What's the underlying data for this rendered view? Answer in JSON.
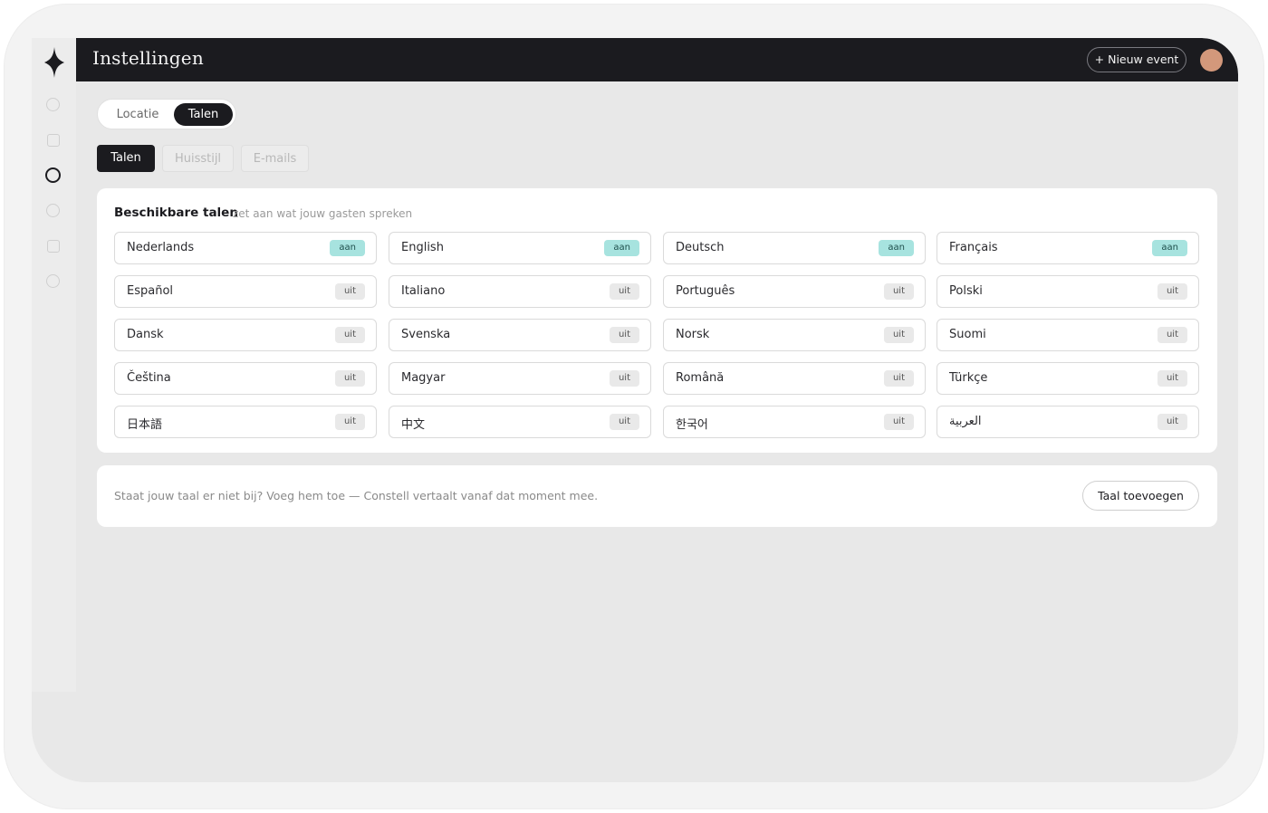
{
  "header": {
    "title": "Instellingen",
    "new_event_label": "+ Nieuw event"
  },
  "segment": {
    "options": [
      "Locatie",
      "Talen"
    ],
    "selected": "Talen"
  },
  "tabs": [
    {
      "label": "Talen",
      "active": true
    },
    {
      "label": "Huisstijl",
      "active": false
    },
    {
      "label": "E-mails",
      "active": false
    }
  ],
  "languages_card": {
    "heading": "Beschikbare talen",
    "subheading": "zet aan wat jouw gasten spreken",
    "items": [
      {
        "name": "Nederlands",
        "status": "aan"
      },
      {
        "name": "English",
        "status": "aan"
      },
      {
        "name": "Deutsch",
        "status": "aan"
      },
      {
        "name": "Français",
        "status": "aan"
      },
      {
        "name": "Español",
        "status": "uit"
      },
      {
        "name": "Italiano",
        "status": "uit"
      },
      {
        "name": "Português",
        "status": "uit"
      },
      {
        "name": "Polski",
        "status": "uit"
      },
      {
        "name": "Dansk",
        "status": "uit"
      },
      {
        "name": "Svenska",
        "status": "uit"
      },
      {
        "name": "Norsk",
        "status": "uit"
      },
      {
        "name": "Suomi",
        "status": "uit"
      },
      {
        "name": "Čeština",
        "status": "uit"
      },
      {
        "name": "Magyar",
        "status": "uit"
      },
      {
        "name": "Română",
        "status": "uit"
      },
      {
        "name": "Türkçe",
        "status": "uit"
      },
      {
        "name": "日本語",
        "status": "uit"
      },
      {
        "name": "中文",
        "status": "uit"
      },
      {
        "name": "한국어",
        "status": "uit"
      },
      {
        "name": "العربية",
        "status": "uit"
      }
    ]
  },
  "footer": {
    "hint": "Staat jouw taal er niet bij? Voeg hem toe — Constell vertaalt vanaf dat moment mee.",
    "add_button_label": "Taal toevoegen"
  },
  "colors": {
    "dark": "#1b1b1f",
    "badge_on": "#a7e3df",
    "badge_off": "#e9e9e9",
    "avatar": "#d3987b"
  },
  "icons": {
    "logo": "four-point-star-icon",
    "rail": [
      "circle-nav-icon",
      "square-nav-icon",
      "circle-nav-icon",
      "circle-nav-icon",
      "square-nav-icon",
      "circle-nav-icon"
    ]
  }
}
